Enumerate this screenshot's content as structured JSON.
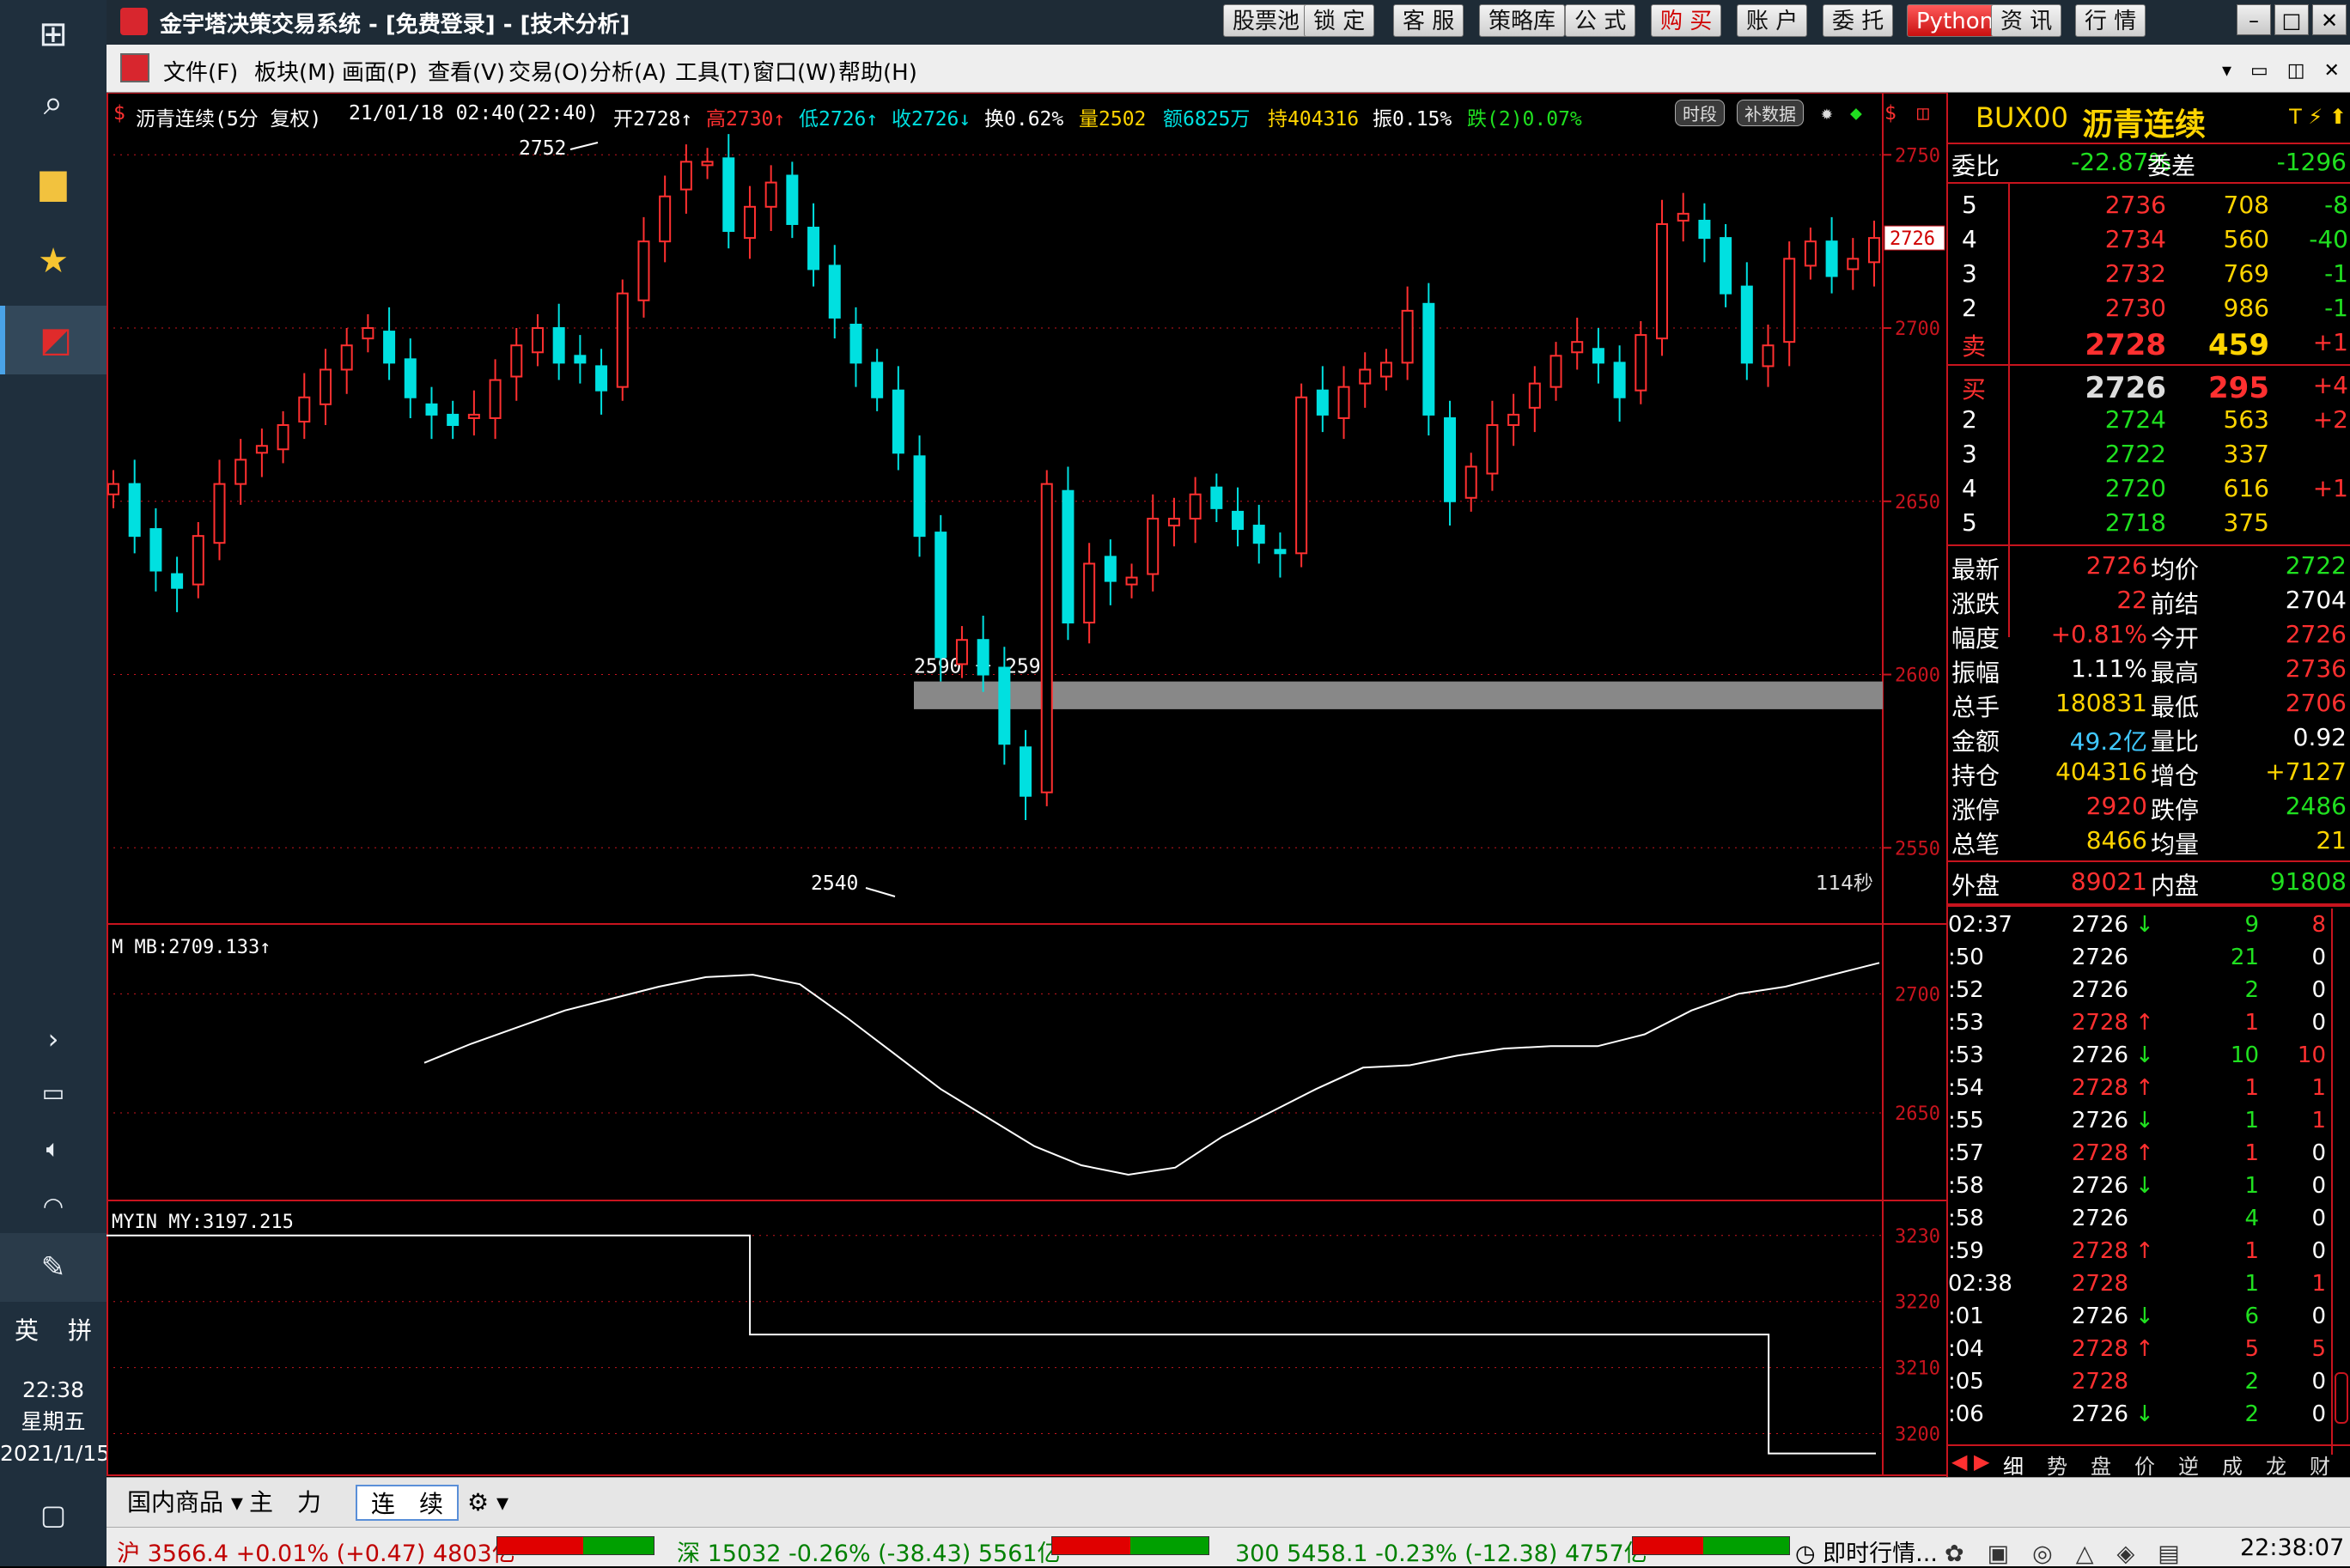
{
  "window": {
    "title": "金宇塔决策交易系统 - [免费登录] - [技术分析]",
    "toolbar": [
      "股票池",
      "锁 定",
      "客 服",
      "策略库",
      "公 式",
      "购 买",
      "账 户",
      "委 托",
      "Python",
      "资 讯",
      "行 情"
    ]
  },
  "menu": [
    "文件(F)",
    "板块(M)",
    "画面(P)",
    "查看(V)",
    "交易(O)",
    "分析(A)",
    "工具(T)",
    "窗口(W)",
    "帮助(H)"
  ],
  "info": {
    "symbol": "沥青连续(5分 复权)",
    "datetime": "21/01/18 02:40(22:40)",
    "open": "开2728↑",
    "high": "高2730↑",
    "low": "低2726↑",
    "close": "收2726↓",
    "turnover": "换0.62%",
    "volume": "量2502",
    "amount": "额6825万",
    "position": "持404316",
    "amplitude": "振0.15%",
    "change": "跌(2)0.07%",
    "btn_period": "时段",
    "btn_fill": "补数据"
  },
  "chart_data": [
    {
      "type": "candlestick",
      "title": "沥青连续(5分 复权)",
      "ylim": [
        2530,
        2758
      ],
      "yticks": [
        2550,
        2600,
        2650,
        2700,
        2750
      ],
      "annotations": {
        "max": "2752",
        "min": "2540",
        "zone": "2590 － 2598",
        "timer": "114秒",
        "last_tag": "2726"
      },
      "x": [
        0,
        4,
        8,
        12,
        16,
        20,
        24,
        28,
        32,
        36,
        40,
        44,
        48,
        52,
        56,
        60,
        64,
        68,
        72,
        76,
        80,
        84,
        88,
        92,
        96,
        100,
        104,
        108,
        112,
        116,
        120,
        124,
        128,
        132,
        136,
        140,
        144,
        148,
        152,
        156,
        160,
        164,
        168,
        172,
        176,
        180,
        184,
        188,
        192,
        196,
        200,
        204,
        208,
        212,
        216,
        220,
        224,
        228,
        232,
        236,
        240,
        244,
        248,
        252,
        256,
        260,
        264,
        268,
        272,
        276,
        280,
        284,
        288,
        292,
        296
      ],
      "close": [
        2655,
        2640,
        2630,
        2625,
        2640,
        2655,
        2662,
        2666,
        2672,
        2680,
        2688,
        2695,
        2700,
        2690,
        2680,
        2675,
        2672,
        2675,
        2685,
        2695,
        2700,
        2690,
        2690,
        2682,
        2710,
        2725,
        2738,
        2748,
        2748,
        2728,
        2735,
        2742,
        2730,
        2717,
        2703,
        2690,
        2680,
        2664,
        2640,
        2605,
        2610,
        2600,
        2580,
        2565,
        2655,
        2615,
        2632,
        2627,
        2628,
        2645,
        2645,
        2652,
        2648,
        2642,
        2638,
        2635,
        2680,
        2675,
        2683,
        2688,
        2690,
        2705,
        2675,
        2650,
        2660,
        2672,
        2675,
        2684,
        2692,
        2696,
        2690,
        2680,
        2698,
        2730,
        2733,
        2726,
        2710,
        2690,
        2695,
        2720,
        2725,
        2715,
        2720,
        2726
      ],
      "dense_note": "84 bars, values read at x index"
    },
    {
      "type": "line",
      "title": "M MB",
      "label": "M MB:2709.133↑",
      "ylim": [
        2615,
        2725
      ],
      "yticks": [
        2650,
        2700
      ],
      "y": [
        2671,
        2679,
        2686,
        2693,
        2698,
        2703,
        2707,
        2708,
        2704,
        2690,
        2675,
        2660,
        2648,
        2636,
        2628,
        2624,
        2627,
        2640,
        2650,
        2660,
        2669,
        2670,
        2674,
        2677,
        2678,
        2678,
        2683,
        2693,
        2700,
        2703,
        2708,
        2713
      ]
    },
    {
      "type": "line",
      "title": "MYIN",
      "label": "MYIN MY:3197.215",
      "ylim": [
        3195,
        3234
      ],
      "yticks": [
        3200,
        3210,
        3220,
        3230
      ],
      "y": [
        3230,
        3230,
        3230,
        3230,
        3230,
        3230,
        3230,
        3230,
        3230,
        3230,
        3230,
        3230,
        3215,
        3215,
        3215,
        3215,
        3215,
        3215,
        3215,
        3215,
        3215,
        3215,
        3215,
        3215,
        3215,
        3215,
        3215,
        3215,
        3215,
        3215,
        3215,
        3197,
        3197,
        3197
      ]
    }
  ],
  "quote": {
    "code": "BUX00",
    "name": "沥青连续",
    "weibi_label": "委比",
    "weibi": "-22.87%",
    "weicha_label": "委差",
    "weicha": "-1296",
    "sells": [
      [
        "5",
        "2736",
        "708",
        "-8"
      ],
      [
        "4",
        "2734",
        "560",
        "-40"
      ],
      [
        "3",
        "2732",
        "769",
        "-1"
      ],
      [
        "2",
        "2730",
        "986",
        "-1"
      ],
      [
        "卖",
        "2728",
        "459",
        "+1"
      ]
    ],
    "buys": [
      [
        "买",
        "2726",
        "295",
        "+4"
      ],
      [
        "2",
        "2724",
        "563",
        "+2"
      ],
      [
        "3",
        "2722",
        "337",
        ""
      ],
      [
        "4",
        "2720",
        "616",
        "+1"
      ],
      [
        "5",
        "2718",
        "375",
        ""
      ]
    ],
    "stats": [
      [
        "最新",
        "2726",
        "均价",
        "2722"
      ],
      [
        "涨跌",
        "22",
        "前结",
        "2704"
      ],
      [
        "幅度",
        "+0.81%",
        "今开",
        "2726"
      ],
      [
        "振幅",
        "1.11%",
        "最高",
        "2736"
      ],
      [
        "总手",
        "180831",
        "最低",
        "2706"
      ],
      [
        "金额",
        "49.2亿",
        "量比",
        "0.92"
      ],
      [
        "持仓",
        "404316",
        "增仓",
        "+7127"
      ],
      [
        "涨停",
        "2920",
        "跌停",
        "2486"
      ],
      [
        "总笔",
        "8466",
        "均量",
        "21"
      ]
    ],
    "outer_label": "外盘",
    "outer": "89021",
    "inner_label": "内盘",
    "inner": "91808",
    "ticks": [
      [
        "02:37",
        "2726",
        "↓",
        "9",
        "8"
      ],
      [
        ":50",
        "2726",
        "",
        "21",
        "0"
      ],
      [
        ":52",
        "2726",
        "",
        "2",
        "0"
      ],
      [
        ":53",
        "2728",
        "↑",
        "1",
        "0"
      ],
      [
        ":53",
        "2726",
        "↓",
        "10",
        "10"
      ],
      [
        ":54",
        "2728",
        "↑",
        "1",
        "1"
      ],
      [
        ":55",
        "2726",
        "↓",
        "1",
        "1"
      ],
      [
        ":57",
        "2728",
        "↑",
        "1",
        "0"
      ],
      [
        ":58",
        "2726",
        "↓",
        "1",
        "0"
      ],
      [
        ":58",
        "2726",
        "",
        "4",
        "0"
      ],
      [
        ":59",
        "2728",
        "↑",
        "1",
        "0"
      ],
      [
        "02:38",
        "2728",
        "",
        "1",
        "1"
      ],
      [
        ":01",
        "2726",
        "↓",
        "6",
        "0"
      ],
      [
        ":04",
        "2728",
        "↑",
        "5",
        "5"
      ],
      [
        ":05",
        "2728",
        "",
        "2",
        "0"
      ],
      [
        ":06",
        "2726",
        "↓",
        "2",
        "0"
      ]
    ],
    "bottom_tabs": [
      "细",
      "势",
      "盘",
      "价",
      "逆",
      "成",
      "龙",
      "财"
    ]
  },
  "bottom_tabs": [
    "国内商品 ▾",
    "主　力",
    "连　续",
    "⚙ ▾"
  ],
  "status": {
    "sh": "沪 3566.4 +0.01% (+0.47) 4803亿",
    "sz": "深 15032 -0.26% (-38.43) 5561亿",
    "cy": "300 5458.1 -0.23% (-12.38) 4757亿",
    "live": "即时行情...",
    "time": "22:38:07",
    "sh_up": 0.55,
    "sz_up": 0.5,
    "cy_up": 0.45
  },
  "taskbar": {
    "time": "22:38",
    "weekday": "星期五",
    "date": "2021/1/15",
    "lang1": "英",
    "lang2": "拼"
  },
  "colors": {
    "up": "#ff3030",
    "down": "#00e0e0",
    "grid": "#c8141e",
    "yellow": "#ffd400",
    "green": "#20e020"
  }
}
